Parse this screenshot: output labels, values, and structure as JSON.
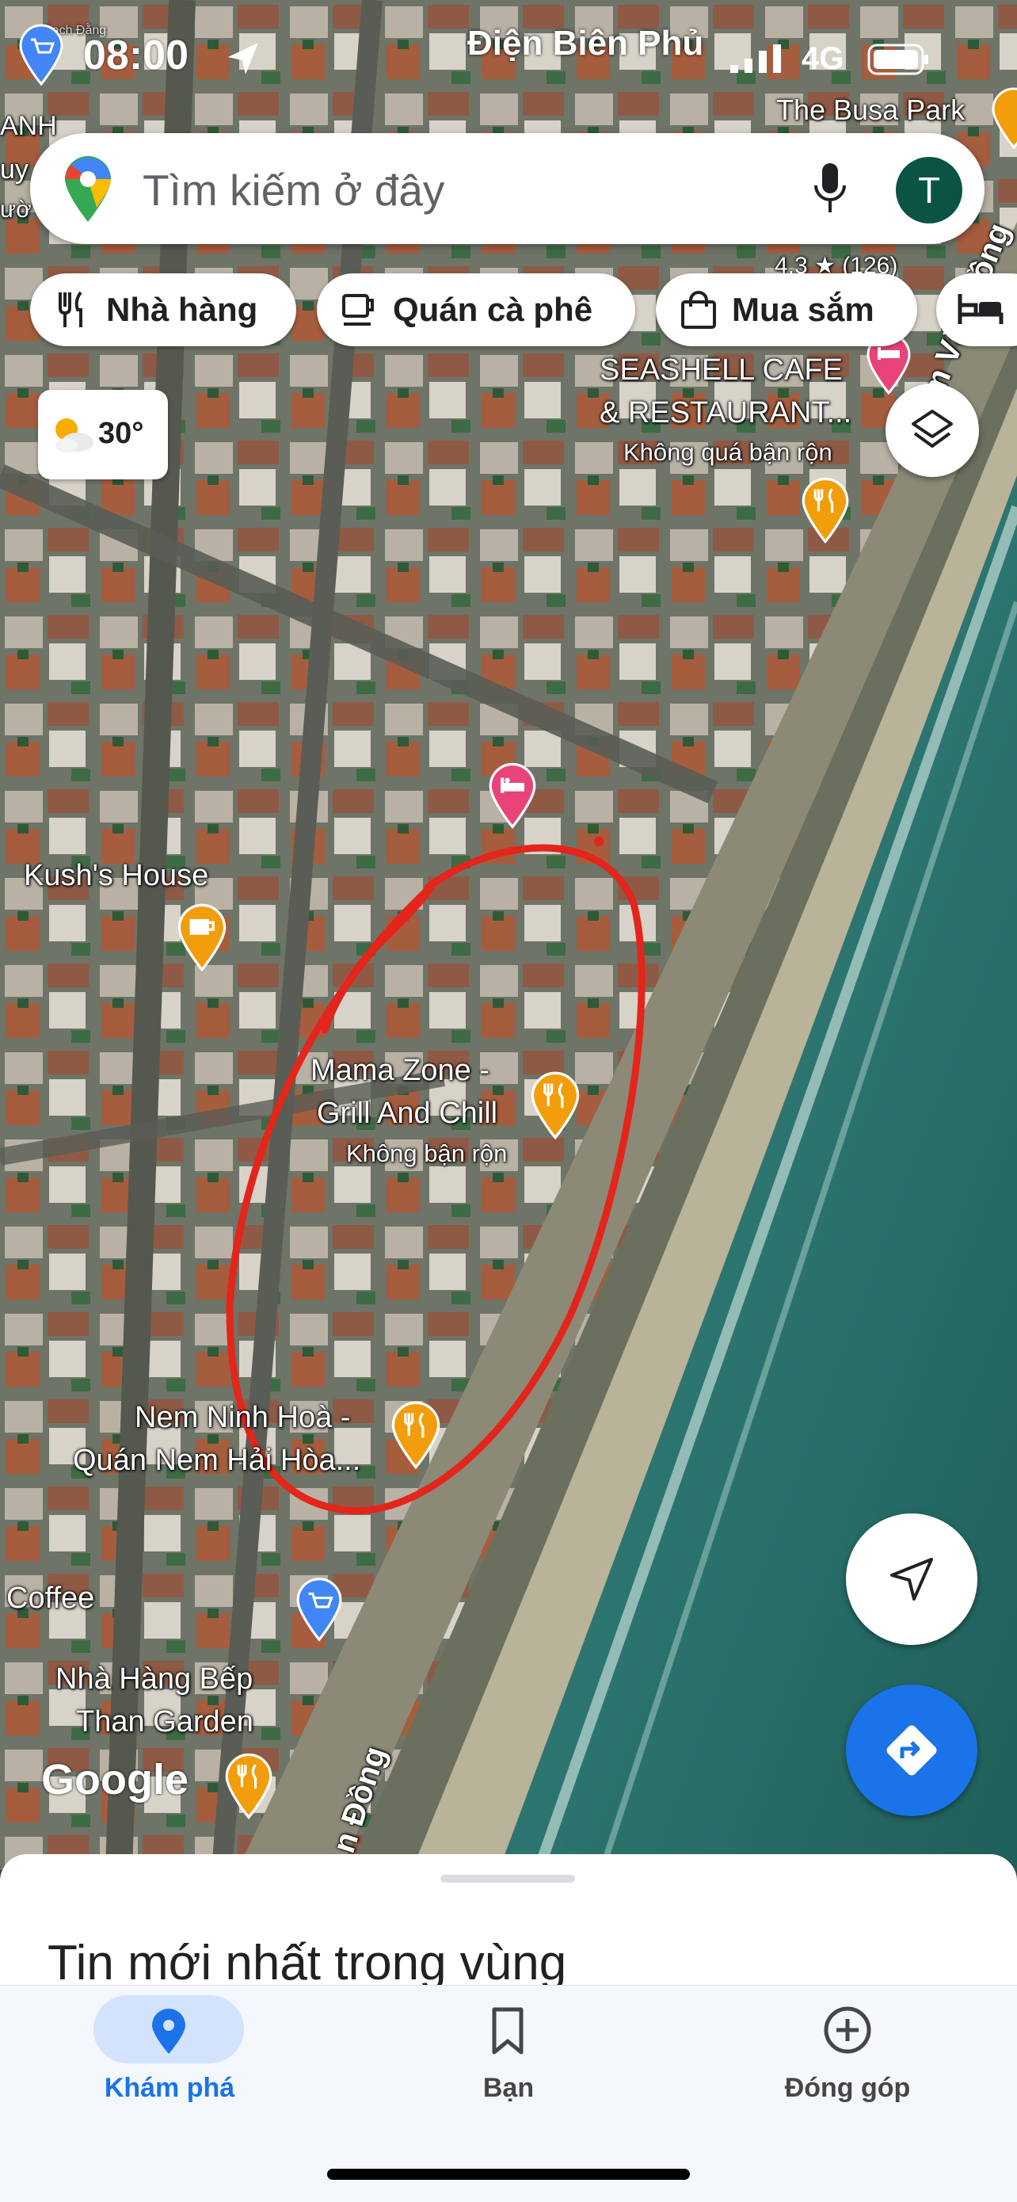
{
  "status_bar": {
    "time": "08:00",
    "street": "Điện Biên Phủ",
    "network": "4G"
  },
  "search": {
    "placeholder": "Tìm kiếm ở đây",
    "avatar_letter": "T"
  },
  "chips": [
    {
      "label": "Nhà hàng",
      "icon": "fork-knife-icon"
    },
    {
      "label": "Quán cà phê",
      "icon": "coffee-cup-icon"
    },
    {
      "label": "Mua sắm",
      "icon": "shopping-bag-icon"
    },
    {
      "label": "",
      "icon": "bed-icon"
    }
  ],
  "weather": {
    "temp": "30°",
    "icon": "partly-cloudy-icon"
  },
  "map_labels": {
    "top_left_1": "ANH",
    "top_left_2": "uy",
    "top_left_3": "ườ",
    "busa_park": "The Busa Park",
    "busa_rating": "4,3 ★ (126)",
    "seashell_1": "SEASHELL CAFE",
    "seashell_2": "& RESTAURANT...",
    "seashell_status": "Không quá bận rộn",
    "road_right": "Phạm Văn Đồng",
    "kush": "Kush's House",
    "mama_1": "Mama Zone -",
    "mama_2": "Grill And Chill",
    "mama_status": "Không bận rộn",
    "nem_1": "Nem Ninh Hoà -",
    "nem_2": "Quán Nem Hải Hòa...",
    "coffee": "Coffee",
    "bep_1": "Nhà Hàng Bếp",
    "bep_2": "Than Garden",
    "road_bottom": "n Đồng",
    "google": "Google",
    "tiny_top": "Bạch Đằng"
  },
  "bottom_sheet": {
    "title": "Tin mới nhất trong vùng"
  },
  "nav": [
    {
      "label": "Khám phá",
      "icon": "location-pin-icon",
      "active": true
    },
    {
      "label": "Bạn",
      "icon": "bookmark-icon",
      "active": false
    },
    {
      "label": "Đóng góp",
      "icon": "add-circle-icon",
      "active": false
    }
  ],
  "colors": {
    "accent": "#1a73e8",
    "annotation": "#e3251b",
    "food_pin": "#f29d0b",
    "hotel_pin": "#e8447a",
    "shop_pin": "#4285f4"
  }
}
